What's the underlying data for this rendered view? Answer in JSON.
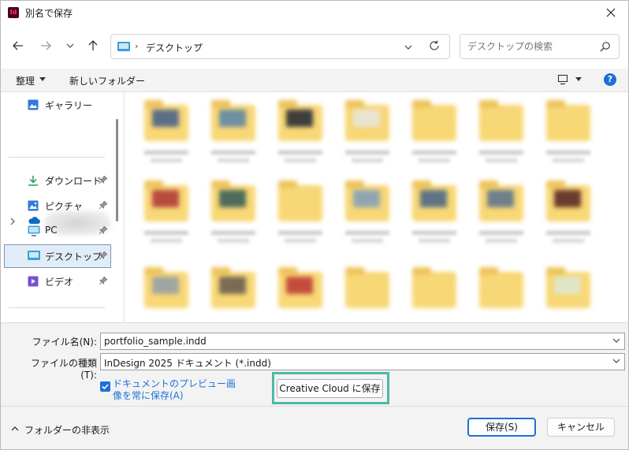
{
  "window": {
    "title": "別名で保存",
    "app_icon_text": "Id"
  },
  "nav": {
    "address_segment": "デスクトップ",
    "search_placeholder": "デスクトップの検索"
  },
  "toolbar": {
    "organize_label": "整理",
    "new_folder_label": "新しいフォルダー",
    "help_label": "?"
  },
  "sidebar": {
    "items": [
      {
        "label": "ギャラリー",
        "icon": "gallery-icon",
        "pinned": false
      },
      {
        "label": "ダウンロード",
        "icon": "download-icon",
        "pinned": true
      },
      {
        "label": "ピクチャ",
        "icon": "pictures-icon",
        "pinned": true
      },
      {
        "label": "PC",
        "icon": "pc-icon",
        "pinned": true
      },
      {
        "label": "デスクトップ",
        "icon": "desktop-icon",
        "pinned": true,
        "selected": true
      },
      {
        "label": "ビデオ",
        "icon": "videos-icon",
        "pinned": true
      }
    ]
  },
  "form": {
    "filename_label": "ファイル名(N):",
    "filename_value": "portfolio_sample.indd",
    "filetype_label": "ファイルの種類(T):",
    "filetype_value": "InDesign 2025 ドキュメント (*.indd)",
    "preview_checkbox_line1": "ドキュメントのプレビュー画",
    "preview_checkbox_line2": "像を常に保存(A)",
    "preview_checked": true,
    "cc_button_label": "Creative Cloud に保存"
  },
  "footer": {
    "hide_folders_label": "フォルダーの非表示",
    "save_label": "保存(S)",
    "cancel_label": "キャンセル"
  },
  "colors": {
    "accent": "#1e6fd9",
    "highlight_outline": "#4dbaa6",
    "folder": "#f8d775"
  }
}
